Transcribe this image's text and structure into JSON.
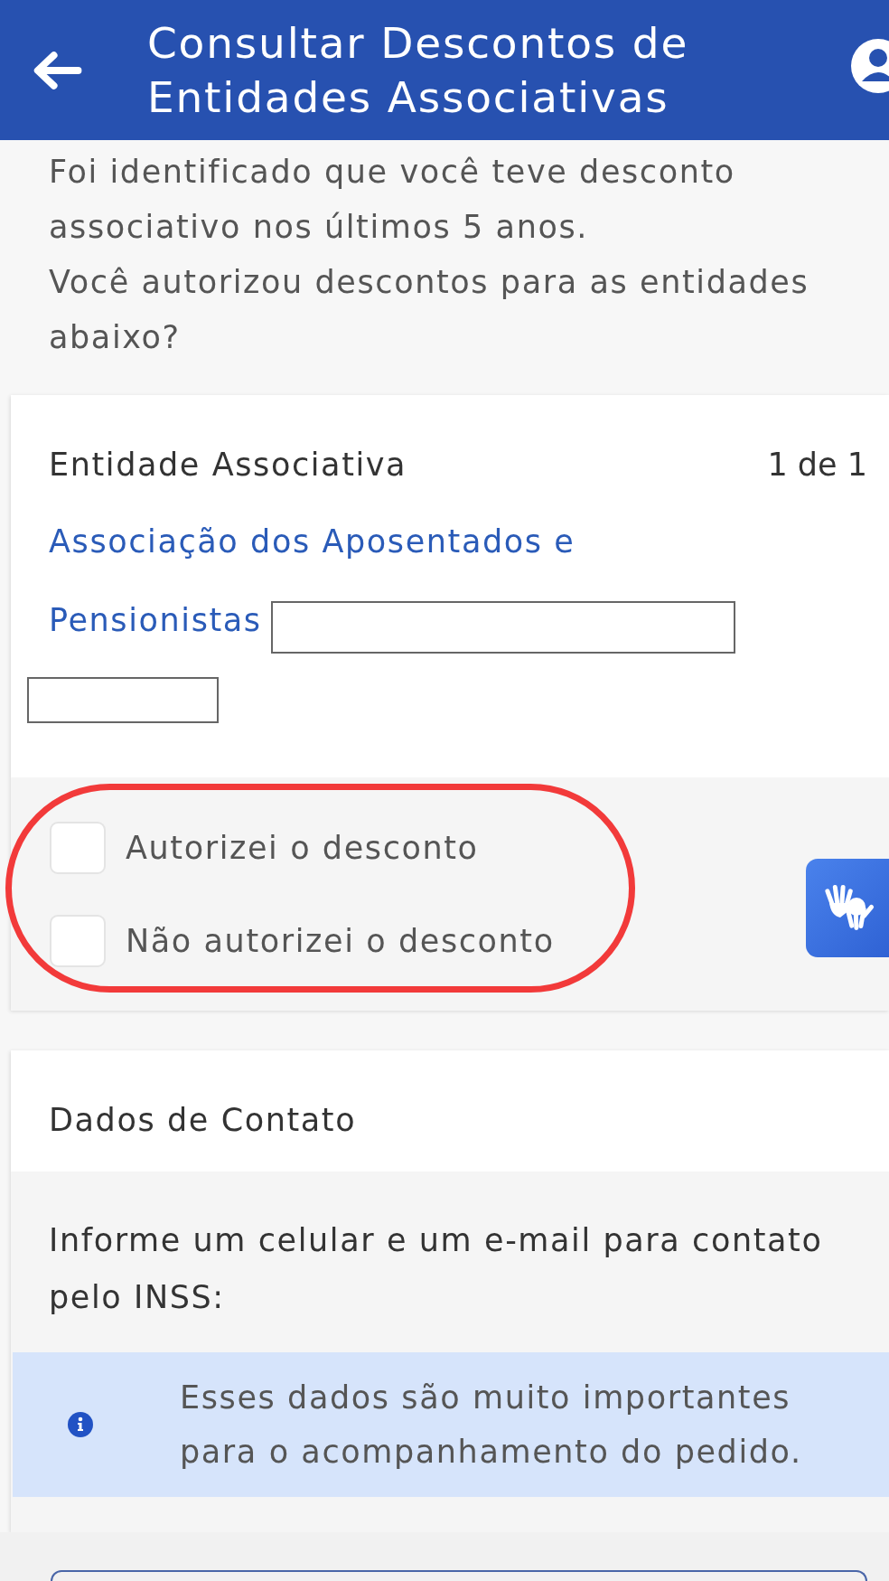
{
  "header": {
    "title": "Consultar Descontos de Entidades Associativas"
  },
  "intro": [
    "Foi identificado que você teve desconto associativo nos últimos 5 anos.",
    "Você autorizou descontos para as entidades abaixo?"
  ],
  "entity_card": {
    "heading": "Entidade Associativa",
    "counter": "1 de 1",
    "entity_name": "Associação dos Aposentados e Pensionistas",
    "options": [
      {
        "label": "Autorizei o desconto",
        "checked": false
      },
      {
        "label": "Não autorizei o desconto",
        "checked": false
      }
    ]
  },
  "contact_card": {
    "heading": "Dados de Contato",
    "prompt": "Informe um celular e um e-mail para contato pelo INSS:",
    "notice": "Esses dados são muito importantes para o acompanhamento do pedido."
  }
}
